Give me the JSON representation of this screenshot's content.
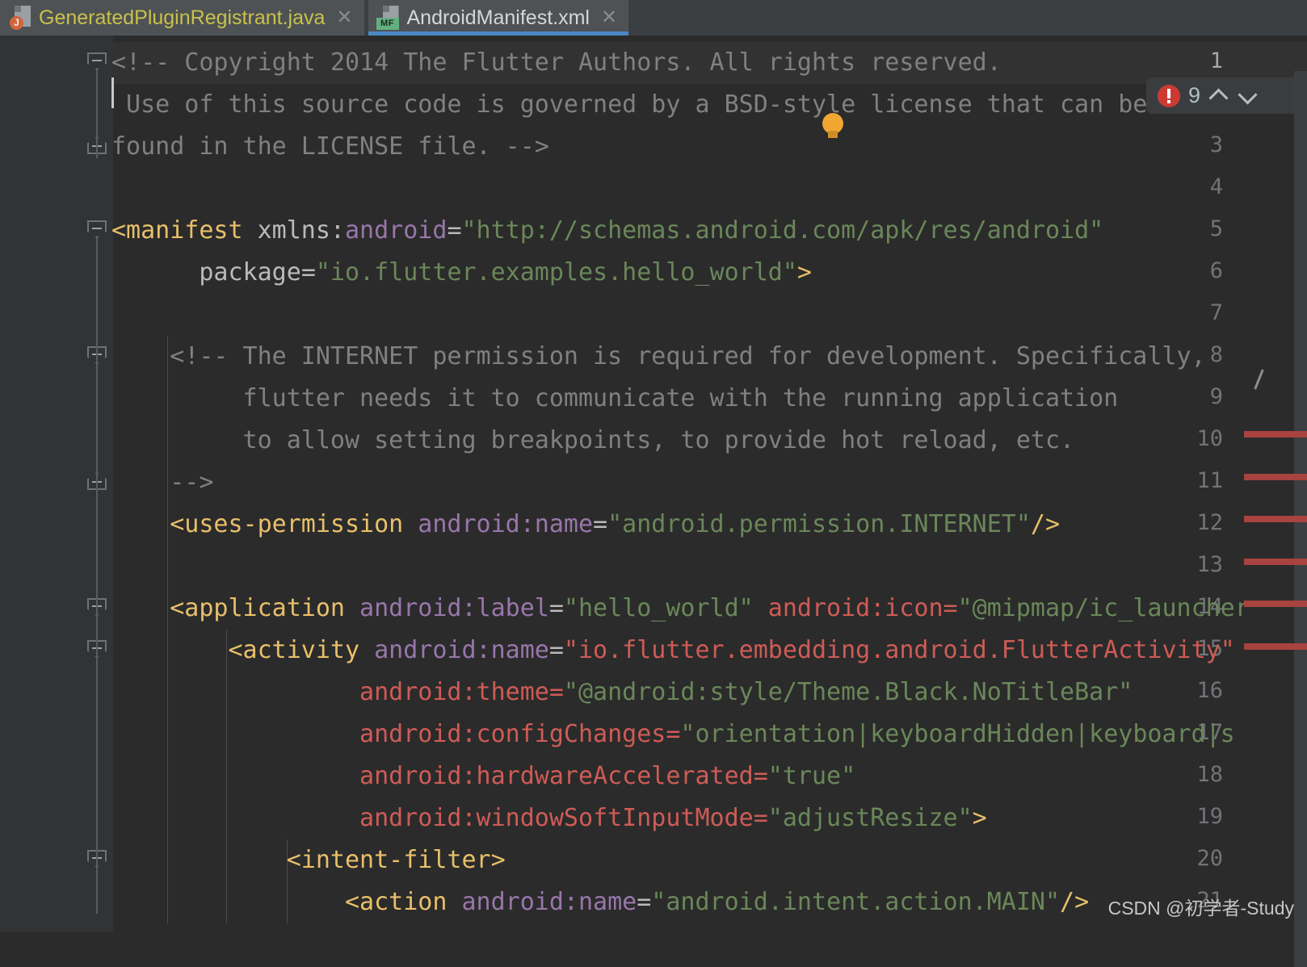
{
  "tabs": [
    {
      "label": "GeneratedPluginRegistrant.java",
      "icon": "java-file-icon",
      "badge": "J",
      "active": false,
      "close": "✕"
    },
    {
      "label": "AndroidManifest.xml",
      "icon": "manifest-file-icon",
      "badge": "MF",
      "active": true,
      "close": "✕"
    }
  ],
  "inspection": {
    "error_icon": "error-circle-icon",
    "count": "9",
    "prev_label": "⌃",
    "next_label": "⌄"
  },
  "intention": {
    "icon": "lightbulb-icon"
  },
  "watermark": "CSDN @初学者-Study",
  "colors": {
    "background": "#2b2b2b",
    "gutter": "#313335",
    "tab_active_underline": "#4a88c7",
    "tag": "#e8bf6a",
    "namespace": "#9876aa",
    "string": "#6a8759",
    "comment": "#808080",
    "error": "#cf5b56",
    "error_badge": "#cc3b33",
    "bulb": "#f0a732",
    "caret": "#c8c8c8"
  },
  "editor": {
    "current_line": 1,
    "lines": [
      {
        "n": "1",
        "segs": [
          {
            "t": "<!-- Copyright 2014 The Flutter Authors. All rights reserved.",
            "c": "cm"
          }
        ]
      },
      {
        "n": "2",
        "segs": [
          {
            "t": " Use of this source code is governed by a BSD-style license that can be",
            "c": "cm"
          }
        ]
      },
      {
        "n": "3",
        "segs": [
          {
            "t": "found in the LICENSE file. -->",
            "c": "cm"
          }
        ]
      },
      {
        "n": "4",
        "segs": []
      },
      {
        "n": "5",
        "segs": [
          {
            "t": "<manifest",
            "c": "tg"
          },
          {
            "t": " xmlns:",
            "c": "at"
          },
          {
            "t": "android",
            "c": "ns"
          },
          {
            "t": "=",
            "c": "at"
          },
          {
            "t": "\"http://schemas.android.com/apk/res/android\"",
            "c": "st"
          }
        ]
      },
      {
        "n": "6",
        "segs": [
          {
            "t": "      package",
            "c": "at"
          },
          {
            "t": "=",
            "c": "at"
          },
          {
            "t": "\"io.flutter.examples.hello_world\"",
            "c": "st"
          },
          {
            "t": ">",
            "c": "tg"
          }
        ]
      },
      {
        "n": "7",
        "segs": []
      },
      {
        "n": "8",
        "segs": [
          {
            "t": "    <!-- The INTERNET permission is required for development. Specifically,",
            "c": "cm"
          }
        ]
      },
      {
        "n": "9",
        "segs": [
          {
            "t": "         flutter needs it to communicate with the running application",
            "c": "cm"
          }
        ]
      },
      {
        "n": "10",
        "segs": [
          {
            "t": "         to allow setting breakpoints, to provide hot reload, etc.",
            "c": "cm"
          }
        ]
      },
      {
        "n": "11",
        "segs": [
          {
            "t": "    -->",
            "c": "cm"
          }
        ]
      },
      {
        "n": "12",
        "segs": [
          {
            "t": "    <uses-permission",
            "c": "tg"
          },
          {
            "t": " ",
            "c": "at"
          },
          {
            "t": "android",
            "c": "ns"
          },
          {
            "t": ":name",
            "c": "ns"
          },
          {
            "t": "=",
            "c": "at"
          },
          {
            "t": "\"android.permission.INTERNET\"",
            "c": "st"
          },
          {
            "t": "/>",
            "c": "tg"
          }
        ]
      },
      {
        "n": "13",
        "segs": []
      },
      {
        "n": "14",
        "segs": [
          {
            "t": "    <application",
            "c": "tg"
          },
          {
            "t": " ",
            "c": "at"
          },
          {
            "t": "android",
            "c": "ns"
          },
          {
            "t": ":label",
            "c": "ns"
          },
          {
            "t": "=",
            "c": "at"
          },
          {
            "t": "\"hello_world\"",
            "c": "st"
          },
          {
            "t": " ",
            "c": "at"
          },
          {
            "t": "android:icon",
            "c": "er"
          },
          {
            "t": "=",
            "c": "er"
          },
          {
            "t": "\"@mipmap/ic_launcher",
            "c": "st"
          }
        ]
      },
      {
        "n": "15",
        "segs": [
          {
            "t": "        <activity",
            "c": "tg"
          },
          {
            "t": " ",
            "c": "at"
          },
          {
            "t": "android",
            "c": "ns"
          },
          {
            "t": ":name",
            "c": "ns"
          },
          {
            "t": "=",
            "c": "at"
          },
          {
            "t": "\"io.flutter.embedding.android.FlutterActivity\"",
            "c": "er"
          }
        ]
      },
      {
        "n": "16",
        "segs": [
          {
            "t": "                 android:theme",
            "c": "er"
          },
          {
            "t": "=",
            "c": "er"
          },
          {
            "t": "\"@android:style/Theme.Black.NoTitleBar\"",
            "c": "st"
          }
        ]
      },
      {
        "n": "17",
        "segs": [
          {
            "t": "                 android:configChanges",
            "c": "er"
          },
          {
            "t": "=",
            "c": "er"
          },
          {
            "t": "\"orientation|keyboardHidden|keyboard|s",
            "c": "st"
          }
        ]
      },
      {
        "n": "18",
        "segs": [
          {
            "t": "                 android:hardwareAccelerated",
            "c": "er"
          },
          {
            "t": "=",
            "c": "er"
          },
          {
            "t": "\"true\"",
            "c": "st"
          }
        ]
      },
      {
        "n": "19",
        "segs": [
          {
            "t": "                 android:windowSoftInputMode",
            "c": "er"
          },
          {
            "t": "=",
            "c": "er"
          },
          {
            "t": "\"adjustResize\"",
            "c": "st"
          },
          {
            "t": ">",
            "c": "tg"
          }
        ]
      },
      {
        "n": "20",
        "segs": [
          {
            "t": "            <intent-filter",
            "c": "tg"
          },
          {
            "t": ">",
            "c": "tg"
          }
        ]
      },
      {
        "n": "21",
        "segs": [
          {
            "t": "                <action",
            "c": "tg"
          },
          {
            "t": " ",
            "c": "at"
          },
          {
            "t": "android",
            "c": "ns"
          },
          {
            "t": ":name",
            "c": "ns"
          },
          {
            "t": "=",
            "c": "at"
          },
          {
            "t": "\"android.intent.action.MAIN\"",
            "c": "st"
          },
          {
            "t": "/>",
            "c": "tg"
          }
        ]
      }
    ],
    "fold_markers": [
      {
        "line": 1,
        "kind": "collapse"
      },
      {
        "line": 3,
        "kind": "endtop"
      },
      {
        "line": 5,
        "kind": "collapse"
      },
      {
        "line": 8,
        "kind": "collapse"
      },
      {
        "line": 11,
        "kind": "endtop"
      },
      {
        "line": 14,
        "kind": "collapse"
      },
      {
        "line": 15,
        "kind": "collapse"
      },
      {
        "line": 20,
        "kind": "collapse"
      }
    ],
    "stripe_marks": [
      490,
      543,
      595,
      648,
      700,
      753
    ]
  }
}
